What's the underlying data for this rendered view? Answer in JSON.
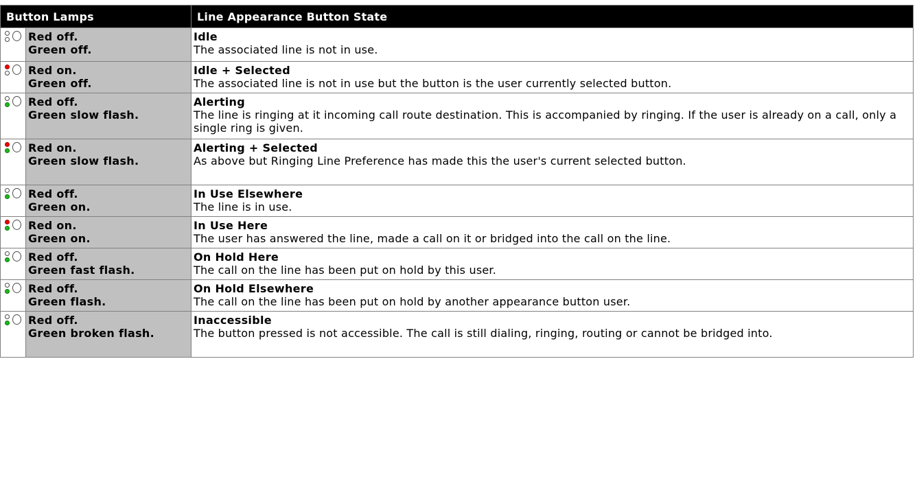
{
  "header": {
    "button_lamps": "Button Lamps",
    "line_state": "Line Appearance Button State"
  },
  "colors": {
    "header_bg": "#000000",
    "header_text": "#ffffff",
    "state_cell_bg": "#c0c0c0",
    "led_red_on": "#f20000",
    "led_green_on": "#1fb81f"
  },
  "rows": [
    {
      "red_on": false,
      "green_on": false,
      "red": "Red off.",
      "green": "Green off.",
      "title": "Idle",
      "description": "The associated line is not in use."
    },
    {
      "red_on": true,
      "green_on": false,
      "red": "Red on.",
      "green": "Green off.",
      "title": "Idle + Selected",
      "description": "The associated line is not in use but the button is the user currently selected button."
    },
    {
      "red_on": false,
      "green_on": true,
      "red": "Red off.",
      "green": "Green slow flash.",
      "title": "Alerting",
      "description": "The line is ringing at it incoming call route destination. This is accompanied by ringing. If the user is already on a call, only a single ring is given."
    },
    {
      "red_on": true,
      "green_on": true,
      "red": "Red on.",
      "green": "Green slow flash.",
      "title": "Alerting + Selected",
      "description": "As above but Ringing Line Preference has made this the user's current selected button."
    },
    {
      "red_on": false,
      "green_on": true,
      "red": "Red off.",
      "green": "Green on.",
      "title": "In Use Elsewhere",
      "description": "The line is in use."
    },
    {
      "red_on": true,
      "green_on": true,
      "red": "Red on.",
      "green": "Green on.",
      "title": "In Use Here",
      "description": "The user has answered the line, made a call on it or bridged into the call on the line."
    },
    {
      "red_on": false,
      "green_on": true,
      "red": "Red off.",
      "green": "Green fast flash.",
      "title": "On Hold Here",
      "description": "The call on the line has been put on hold by this user."
    },
    {
      "red_on": false,
      "green_on": true,
      "red": "Red off.",
      "green": "Green flash.",
      "title": "On Hold Elsewhere",
      "description": "The call on the line has been put on hold by another appearance button user."
    },
    {
      "red_on": false,
      "green_on": true,
      "red": "Red off.",
      "green": "Green broken flash.",
      "title": "Inaccessible",
      "description": "The button pressed is not accessible. The call is still dialing, ringing, routing or cannot be bridged into."
    }
  ]
}
